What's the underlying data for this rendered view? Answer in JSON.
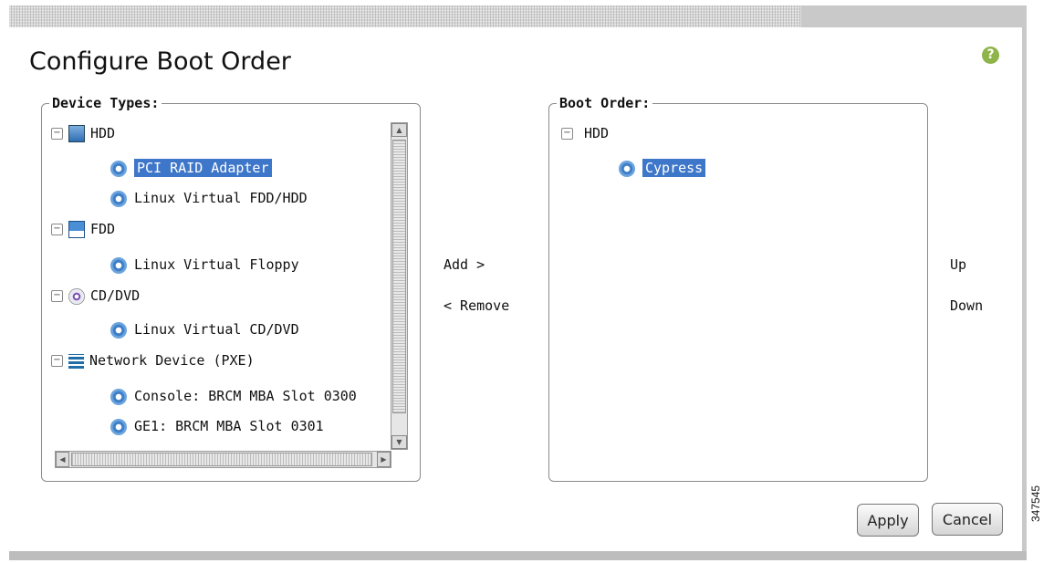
{
  "title": "Configure Boot Order",
  "help_icon": "help-icon",
  "device_types": {
    "legend": "Device Types:",
    "groups": [
      {
        "label": "HDD",
        "icon": "hdd-icon",
        "items": [
          "PCI RAID Adapter",
          "Linux Virtual FDD/HDD"
        ]
      },
      {
        "label": "FDD",
        "icon": "floppy-icon",
        "items": [
          "Linux Virtual Floppy"
        ]
      },
      {
        "label": "CD/DVD",
        "icon": "cd-icon",
        "items": [
          "Linux Virtual CD/DVD"
        ]
      },
      {
        "label": "Network Device (PXE)",
        "icon": "network-icon",
        "items": [
          "Console: BRCM MBA Slot 0300",
          "GE1: BRCM MBA Slot 0301"
        ]
      }
    ],
    "selected": "PCI RAID Adapter"
  },
  "boot_order": {
    "legend": "Boot Order:",
    "groups": [
      {
        "label": "HDD",
        "items": [
          "Cypress"
        ]
      }
    ],
    "selected": "Cypress"
  },
  "actions": {
    "add": "Add >",
    "remove": "< Remove",
    "up": "Up",
    "down": "Down",
    "apply": "Apply",
    "cancel": "Cancel"
  },
  "figure_id": "347545",
  "colors": {
    "selection": "#3e77c9",
    "help": "#8fb44a",
    "gear": "#3e7fc7"
  }
}
